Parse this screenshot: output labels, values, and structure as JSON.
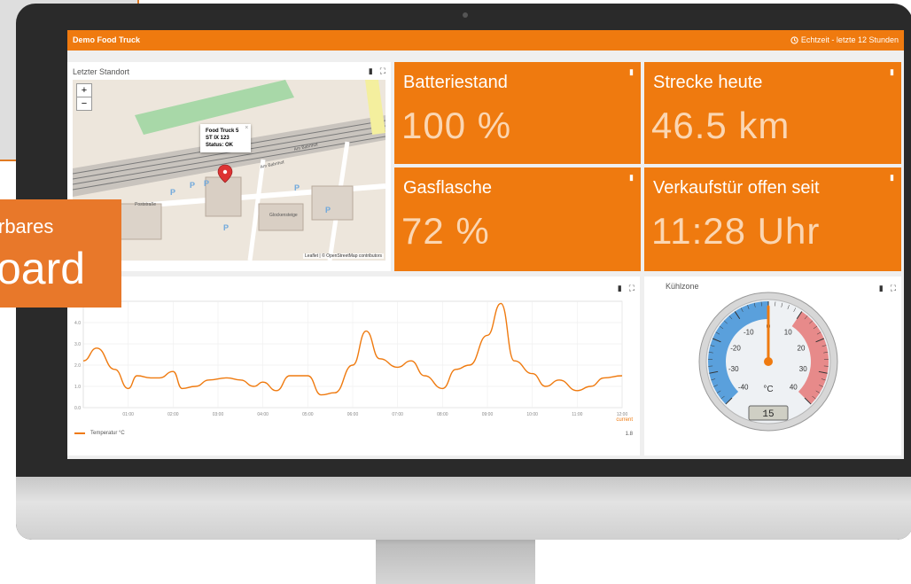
{
  "background_card": {},
  "promo": {
    "line1": "rbares",
    "line2": "oard"
  },
  "dashboard": {
    "title": "Demo Food Truck",
    "time_window": "Echtzeit - letzte 12 Stunden",
    "accent_color": "#ef7a0f"
  },
  "map_panel": {
    "title": "Letzter Standort",
    "zoom_in": "+",
    "zoom_out": "−",
    "popup": {
      "line1": "Food Truck 5",
      "line2": "ST IX 123",
      "line3": "Status: OK",
      "close": "×"
    },
    "labels": {
      "bahnhof1": "Am Bahnhof",
      "bahnhof2": "Am Bahnhof",
      "post": "Poststraße",
      "glocken": "Glockensteige"
    },
    "attribution": "Leaflet | © OpenStreetMap contributors"
  },
  "tiles": [
    {
      "label": "Batteriestand",
      "value": "100 %"
    },
    {
      "label": "Strecke heute",
      "value": "46.5 km"
    },
    {
      "label": "Gasflasche",
      "value": "72 %"
    },
    {
      "label": "Verkaufstür offen seit",
      "value": "11:28 Uhr"
    }
  ],
  "chart_panel": {
    "legend": "Temperatur °C",
    "current_label": "current",
    "current_value": "1.8"
  },
  "chart_data": {
    "type": "line",
    "x_ticks": [
      "01:00",
      "02:00",
      "03:00",
      "04:00",
      "05:00",
      "06:00",
      "07:00",
      "08:00",
      "09:00",
      "10:00",
      "11:00",
      "12:00"
    ],
    "y_ticks": [
      "0.0",
      "1.0",
      "2.0",
      "3.0",
      "4.0"
    ],
    "ylim": [
      0,
      5
    ],
    "series": [
      {
        "name": "Temperatur °C",
        "color": "#ef7a0f",
        "x": [
          0,
          0.3,
          0.7,
          1,
          1.2,
          1.5,
          1.7,
          2,
          2.2,
          2.5,
          2.8,
          3.2,
          3.5,
          3.8,
          4,
          4.3,
          4.6,
          5,
          5.3,
          5.6,
          6,
          6.3,
          6.6,
          7,
          7.3,
          7.6,
          8,
          8.3,
          8.6,
          9,
          9.3,
          9.6,
          10,
          10.3,
          10.6,
          11,
          11.3,
          11.6,
          12
        ],
        "values": [
          2.2,
          2.8,
          1.8,
          0.9,
          1.5,
          1.4,
          1.4,
          1.7,
          0.9,
          1.0,
          1.3,
          1.4,
          1.3,
          1.0,
          1.2,
          0.8,
          1.5,
          1.5,
          0.6,
          0.7,
          2.0,
          3.6,
          2.3,
          1.9,
          2.2,
          1.5,
          0.9,
          1.8,
          2.0,
          3.4,
          4.9,
          2.2,
          1.6,
          1.0,
          1.3,
          0.8,
          1.0,
          1.4,
          1.5
        ]
      }
    ]
  },
  "gauge_panel": {
    "title": "Kühlzone",
    "unit": "°C",
    "value": 0,
    "readout": "15",
    "ticks": [
      "-40",
      "-30",
      "-20",
      "-10",
      "0",
      "10",
      "20",
      "30",
      "40"
    ],
    "min": -40,
    "max": 40,
    "cold_color": "#5aa0dc",
    "warm_color": "#e78a8a"
  }
}
